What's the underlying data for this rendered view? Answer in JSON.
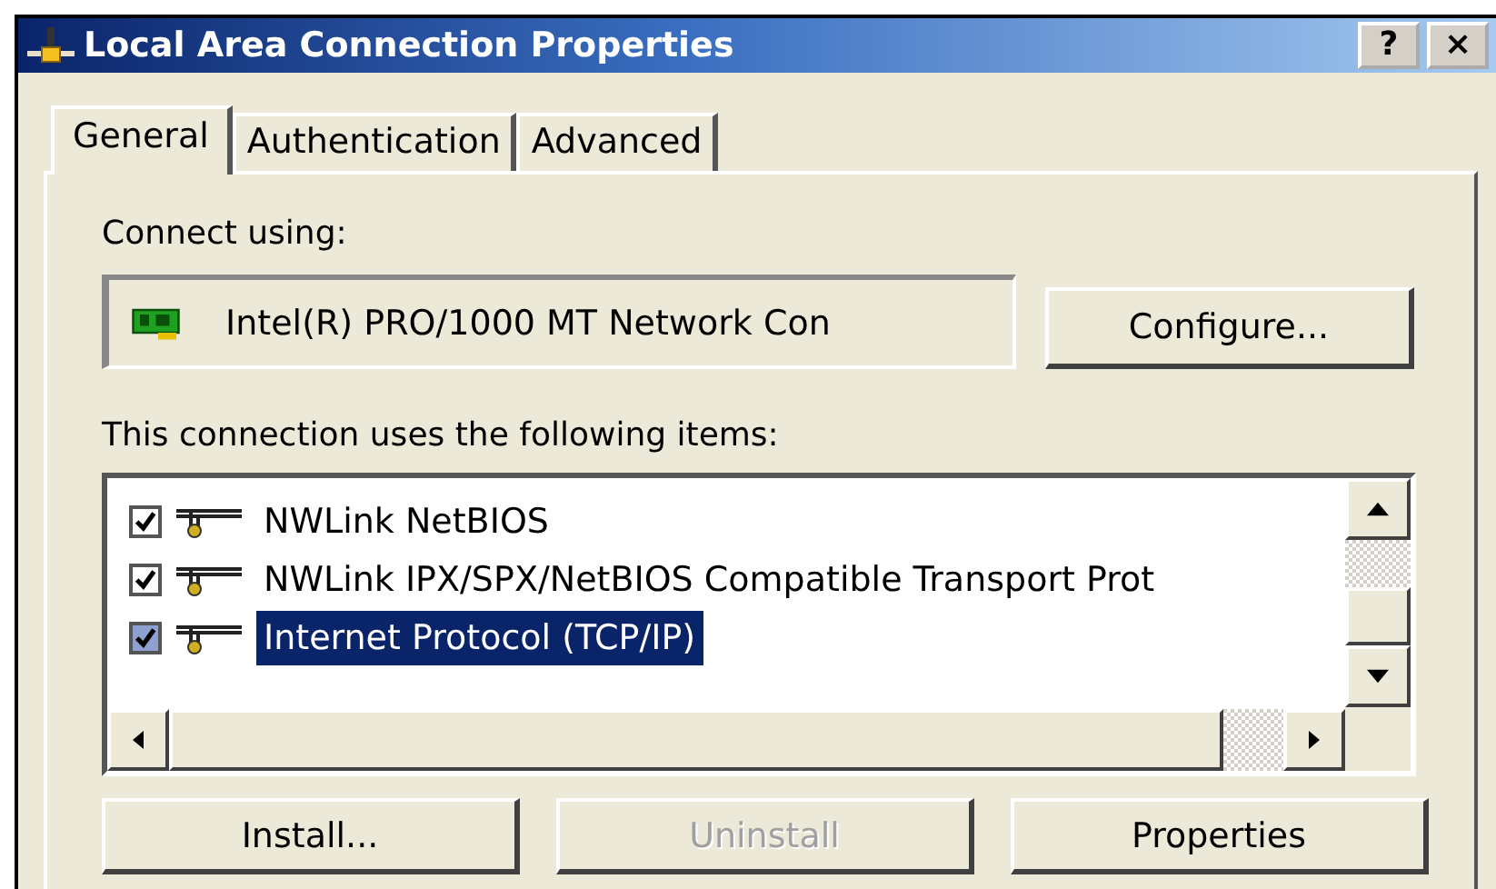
{
  "window": {
    "title": "Local Area Connection Properties",
    "help": "?",
    "close": "×"
  },
  "tabs": [
    {
      "label": "General",
      "selected": true
    },
    {
      "label": "Authentication",
      "selected": false
    },
    {
      "label": "Advanced",
      "selected": false
    }
  ],
  "connect_label": "Connect using:",
  "adapter": "Intel(R) PRO/1000 MT Network Con",
  "configure_button": "Configure...",
  "items_label": "This connection uses the following items:",
  "items": [
    {
      "label": "NWLink NetBIOS",
      "checked": true,
      "selected": false
    },
    {
      "label": "NWLink IPX/SPX/NetBIOS Compatible Transport Prot",
      "checked": true,
      "selected": false
    },
    {
      "label": "Internet Protocol (TCP/IP)",
      "checked": true,
      "selected": true
    }
  ],
  "buttons": [
    {
      "label": "Install...",
      "disabled": false
    },
    {
      "label": "Uninstall",
      "disabled": true
    },
    {
      "label": "Properties",
      "disabled": false
    }
  ]
}
